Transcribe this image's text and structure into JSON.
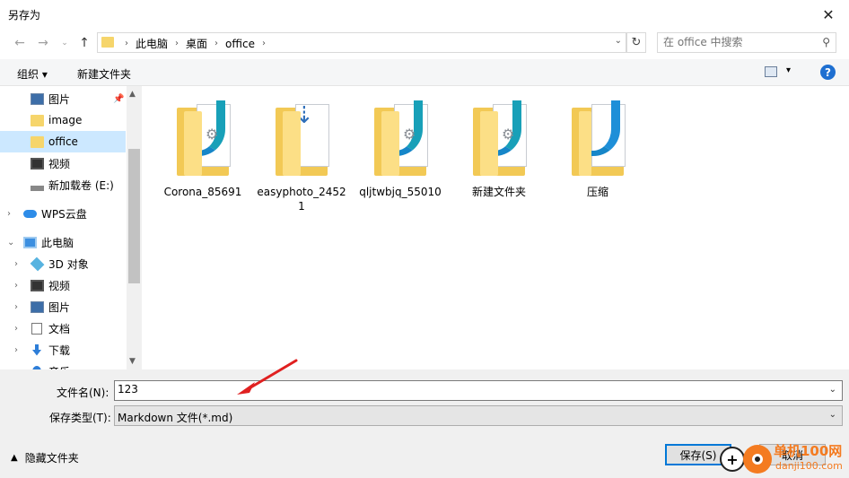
{
  "window": {
    "title": "另存为"
  },
  "nav": {
    "breadcrumbs": [
      "此电脑",
      "桌面",
      "office"
    ],
    "search_placeholder": "在 office 中搜索"
  },
  "toolbar": {
    "organize": "组织 ▾",
    "new_folder": "新建文件夹",
    "help": "?"
  },
  "sidebar": {
    "items": [
      {
        "label": "图片",
        "icon": "picture-icon",
        "pinned": true
      },
      {
        "label": "image",
        "icon": "folder-icon"
      },
      {
        "label": "office",
        "icon": "folder-icon",
        "selected": true
      },
      {
        "label": "视频",
        "icon": "video-icon"
      },
      {
        "label": "新加载卷 (E:)",
        "icon": "drive-icon"
      },
      {
        "label": "WPS云盘",
        "icon": "cloud-icon"
      },
      {
        "label": "此电脑",
        "icon": "computer-icon"
      },
      {
        "label": "3D 对象",
        "icon": "3d-objects-icon"
      },
      {
        "label": "视频",
        "icon": "video-icon"
      },
      {
        "label": "图片",
        "icon": "picture-icon"
      },
      {
        "label": "文档",
        "icon": "document-icon"
      },
      {
        "label": "下载",
        "icon": "download-icon"
      },
      {
        "label": "音乐",
        "icon": "music-icon"
      }
    ]
  },
  "files": [
    {
      "name": "Corona_85691",
      "type": "app-folder"
    },
    {
      "name": "easyphoto_24521",
      "type": "download-folder"
    },
    {
      "name": "qljtwbjq_55010",
      "type": "app-folder"
    },
    {
      "name": "新建文件夹",
      "type": "app-folder"
    },
    {
      "name": "压缩",
      "type": "edge-folder"
    }
  ],
  "form": {
    "filename_label": "文件名(N):",
    "filename_value": "123",
    "filetype_label": "保存类型(T):",
    "filetype_value": "Markdown 文件(*.md)",
    "hide_folders": "隐藏文件夹",
    "save": "保存(S)",
    "cancel": "取消"
  },
  "watermark": {
    "text": "单机100网",
    "url": "danji100.com"
  },
  "colors": {
    "selection": "#cce8ff",
    "accent": "#0078d7",
    "annotation_arrow": "#e02020"
  }
}
